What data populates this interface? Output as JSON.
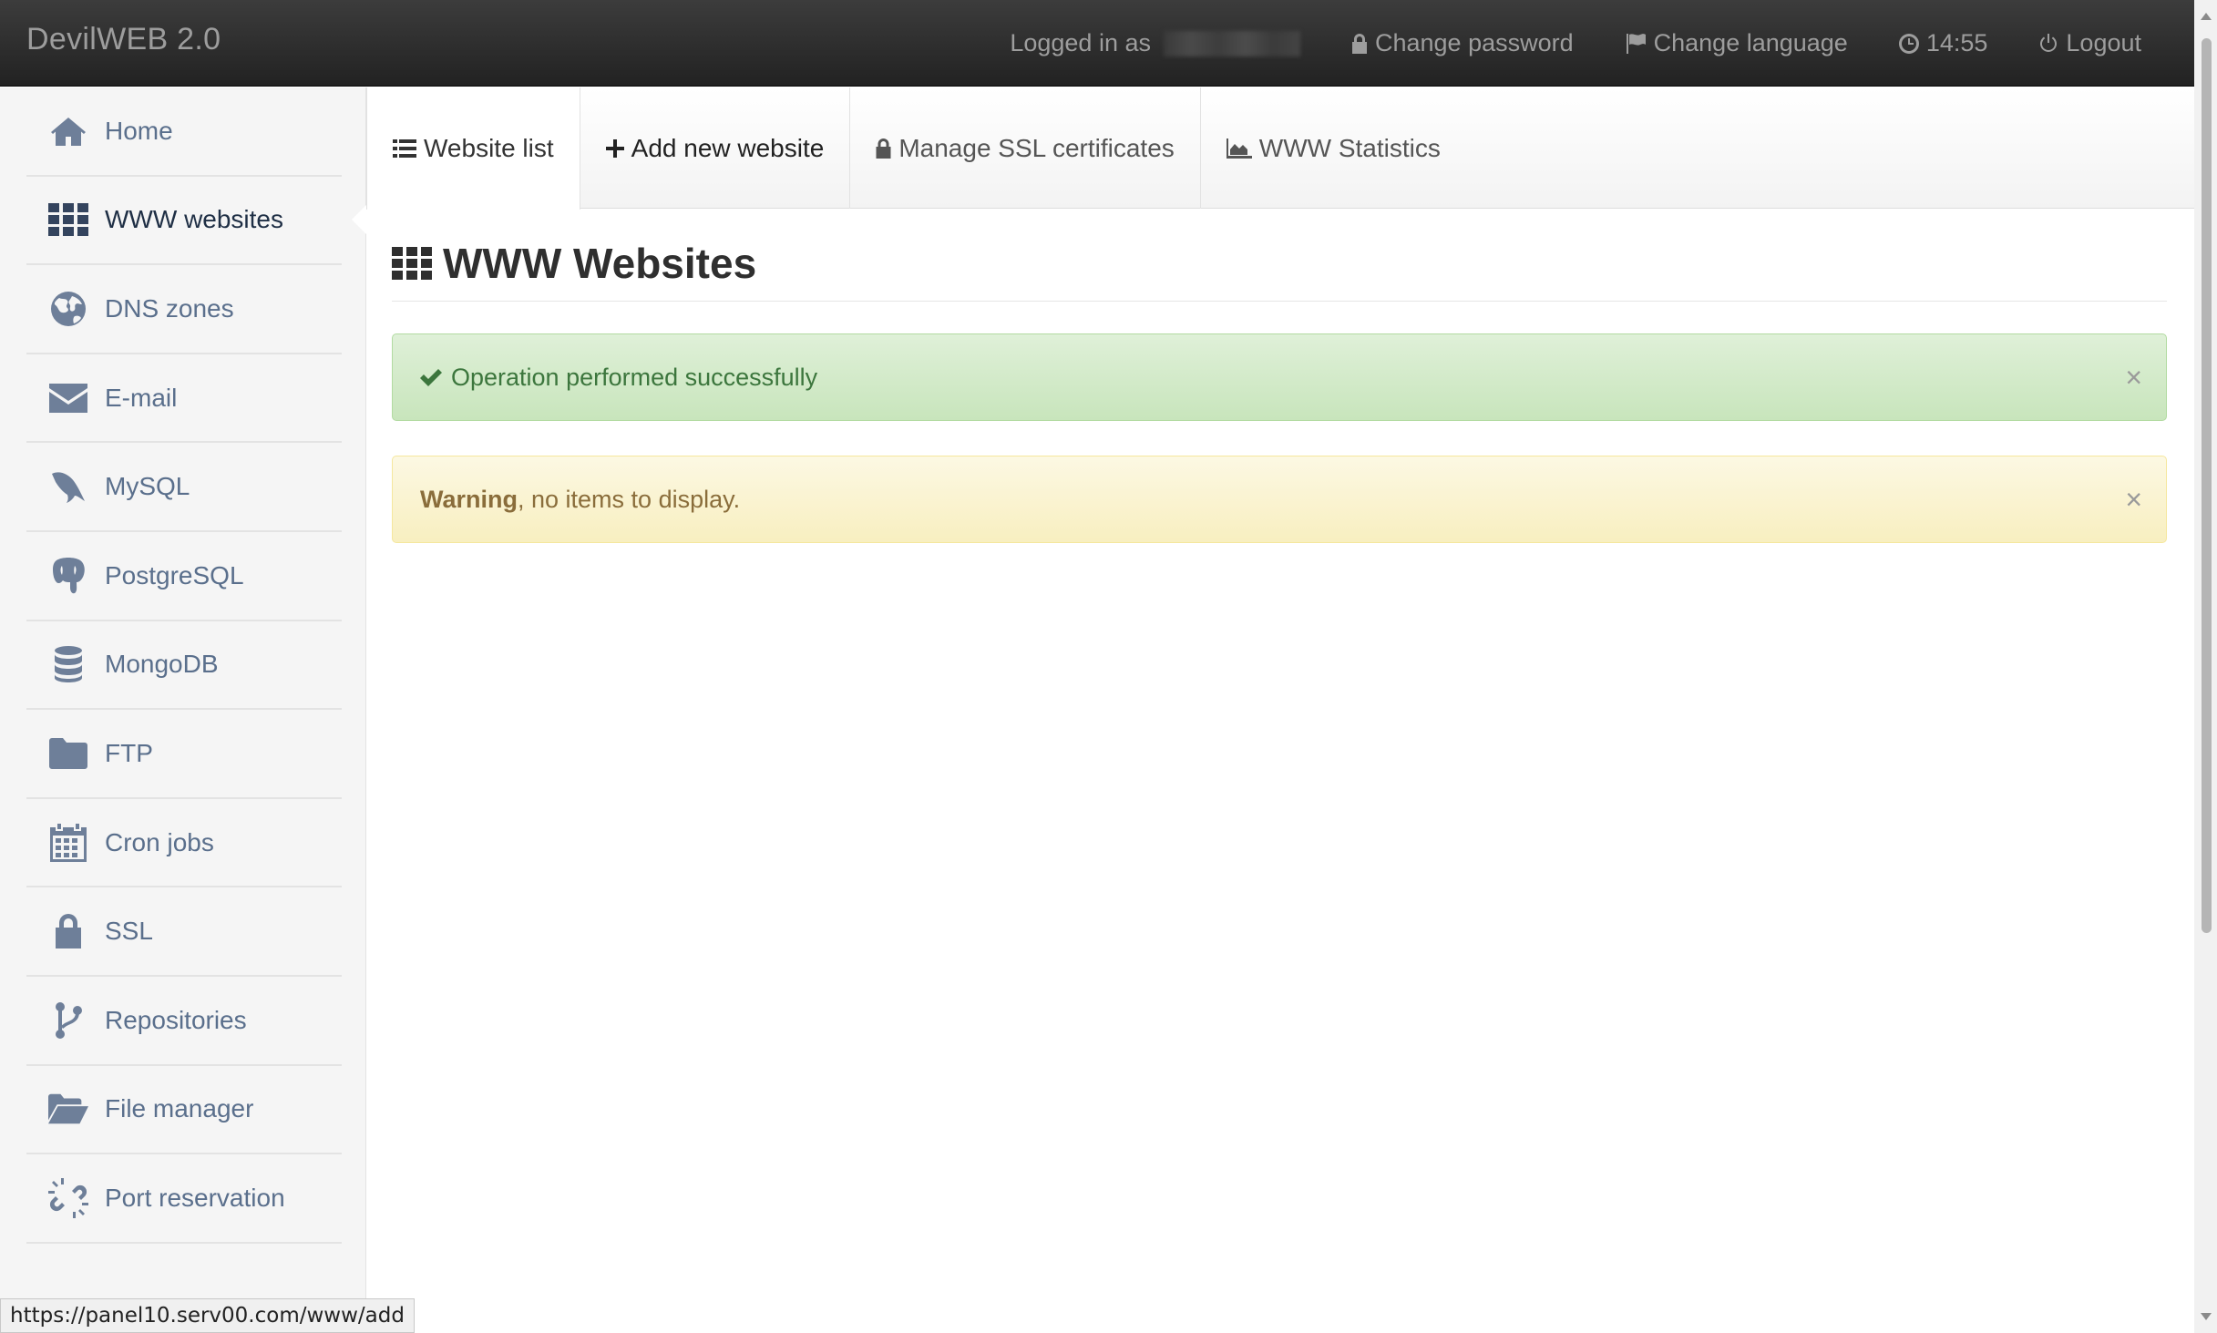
{
  "navbar": {
    "brand": "DevilWEB 2.0",
    "logged_in_label": "Logged in as",
    "change_password": "Change password",
    "change_language": "Change language",
    "time": "14:55",
    "logout": "Logout"
  },
  "sidebar": {
    "items": [
      {
        "label": "Home",
        "icon": "home-icon"
      },
      {
        "label": "WWW websites",
        "icon": "grid-icon",
        "active": true
      },
      {
        "label": "DNS zones",
        "icon": "globe-icon"
      },
      {
        "label": "E-mail",
        "icon": "envelope-icon"
      },
      {
        "label": "MySQL",
        "icon": "dolphin-icon"
      },
      {
        "label": "PostgreSQL",
        "icon": "elephant-icon"
      },
      {
        "label": "MongoDB",
        "icon": "database-icon"
      },
      {
        "label": "FTP",
        "icon": "folder-icon"
      },
      {
        "label": "Cron jobs",
        "icon": "calendar-icon"
      },
      {
        "label": "SSL",
        "icon": "lock-icon"
      },
      {
        "label": "Repositories",
        "icon": "branch-icon"
      },
      {
        "label": "File manager",
        "icon": "folder-open-icon"
      },
      {
        "label": "Port reservation",
        "icon": "unlink-icon"
      }
    ]
  },
  "tabs": {
    "website_list": "Website list",
    "add_new_website": "Add new website",
    "manage_ssl": "Manage SSL certificates",
    "www_statistics": "WWW Statistics"
  },
  "main": {
    "title": "WWW Websites",
    "success_message": "Operation performed successfully",
    "warning_strong": "Warning",
    "warning_message": ", no items to display.",
    "close_symbol": "×"
  },
  "status_url": "https://panel10.serv00.com/www/add",
  "colors": {
    "navbar_bg": "#222222",
    "success_bg": "#dff0d8",
    "warning_bg": "#fcf8e3",
    "sidebar_text": "#5a6f8c"
  }
}
